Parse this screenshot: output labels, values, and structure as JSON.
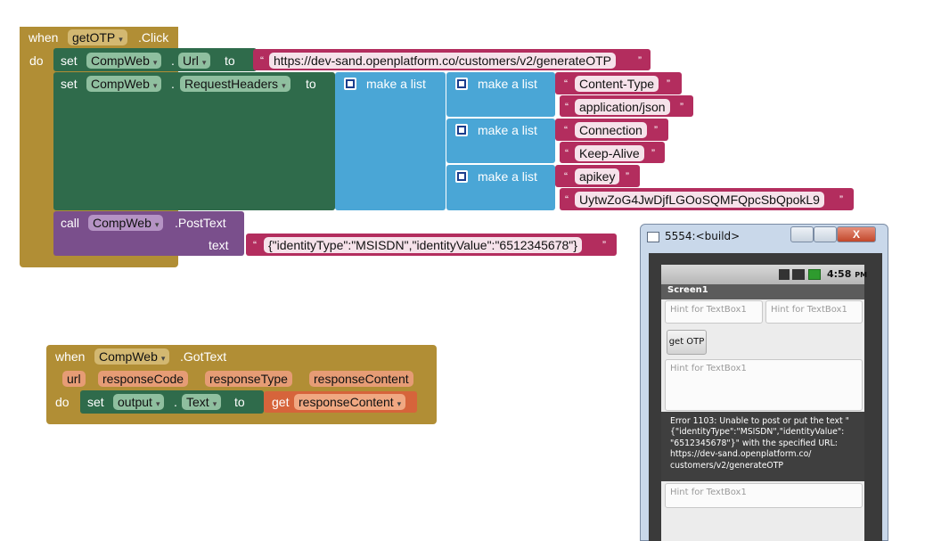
{
  "block1": {
    "when": "when",
    "event_component": "getOTP",
    "event_name": ".Click",
    "do": "do",
    "set1": {
      "set": "set",
      "component": "CompWeb",
      "dot": ".",
      "property": "Url",
      "to": "to",
      "value": "https://dev-sand.openplatform.co/customers/v2/generateOTP"
    },
    "set2": {
      "set": "set",
      "component": "CompWeb",
      "dot": ".",
      "property": "RequestHeaders",
      "to": "to",
      "make_list": "make a list",
      "pairs": [
        {
          "key": "Content-Type",
          "value": "application/json"
        },
        {
          "key": "Connection",
          "value": "Keep-Alive"
        },
        {
          "key": "apikey",
          "value": "UytwZoG4JwDjfLGOoSQMFQpcSbQpokL9"
        }
      ]
    },
    "call": {
      "call": "call",
      "component": "CompWeb",
      "method": ".PostText",
      "arg_label": "text",
      "arg_value": "{\"identityType\":\"MSISDN\",\"identityValue\":\"6512345678\"}"
    }
  },
  "block2": {
    "when": "when",
    "component": "CompWeb",
    "event_name": ".GotText",
    "params": [
      "url",
      "responseCode",
      "responseType",
      "responseContent"
    ],
    "do": "do",
    "set": "set",
    "target": "output",
    "dot": ".",
    "property": "Text",
    "to": "to",
    "get": "get",
    "get_var": "responseContent"
  },
  "emulator": {
    "title": "5554:<build>",
    "status_time": "4:58",
    "status_ampm": "PM",
    "screen_title": "Screen1",
    "hint1": "Hint for TextBox1",
    "hint2": "Hint for TextBox1",
    "button": "get OTP",
    "hint3": "Hint for TextBox1",
    "error": "Error 1103: Unable to post or put the text \"{\"identityType\":\"MSISDN\",\"identityValue\": \"6512345678\"}\" with the specified URL: https://dev-sand.openplatform.co/ customers/v2/generateOTP",
    "hint4": "Hint for TextBox1",
    "close_label": "X"
  },
  "colors": {
    "event": "#b18e35",
    "setter": "#2f6b4b",
    "call": "#7a4f8c",
    "list": "#4aa6d6",
    "text": "#b32d5e"
  }
}
